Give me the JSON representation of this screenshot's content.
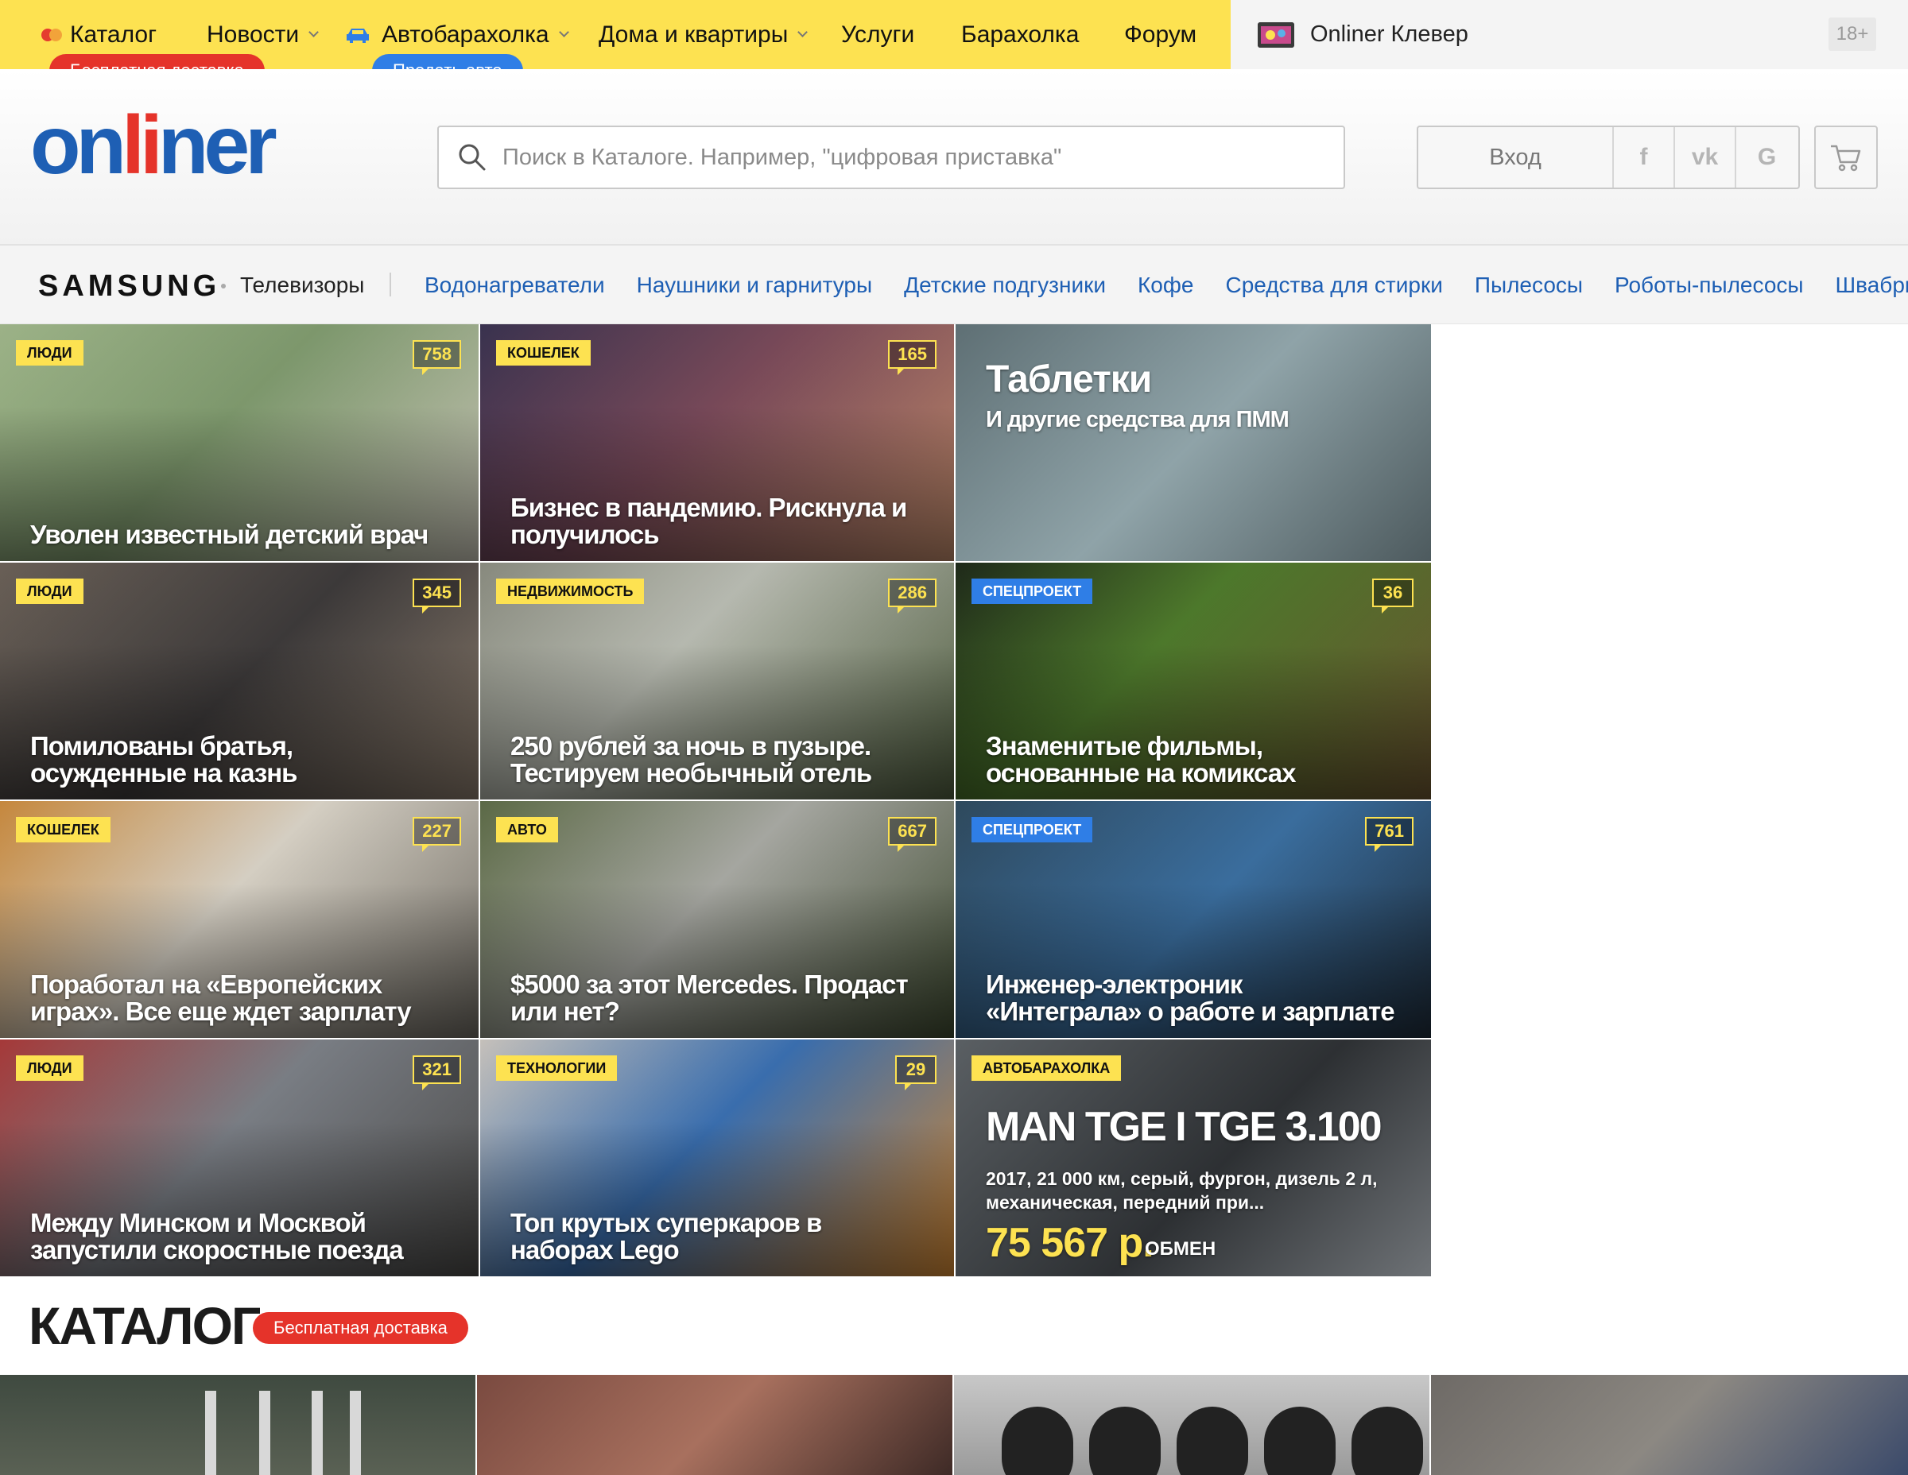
{
  "topnav": {
    "items": [
      {
        "label": "Каталог"
      },
      {
        "label": "Новости"
      },
      {
        "label": "Автобарахолка"
      },
      {
        "label": "Дома и квартиры"
      },
      {
        "label": "Услуги"
      },
      {
        "label": "Барахолка"
      },
      {
        "label": "Форум"
      }
    ],
    "catalog_badge": "Бесплатная доставка",
    "auto_badge": "Продать авто",
    "klever_label": "Onliner Клевер",
    "age_rating": "18+"
  },
  "header": {
    "logo": {
      "part1": "on",
      "part2": "li",
      "part3": "ner"
    },
    "search_placeholder": "Поиск в Каталоге. Например, \"цифровая приставка\"",
    "login_label": "Вход",
    "social": [
      "f",
      "vk",
      "G"
    ]
  },
  "catbar": {
    "brand": "SAMSUNG",
    "featured": "Телевизоры",
    "links": [
      "Водонагреватели",
      "Наушники и гарнитуры",
      "Детские подгузники",
      "Кофе",
      "Средства для стирки",
      "Пылесосы",
      "Роботы-пылесосы",
      "Швабры"
    ]
  },
  "news": [
    {
      "rubric": "ЛЮДИ",
      "comments": "758",
      "title": "Уволен известный детский врач"
    },
    {
      "rubric": "КОШЕЛЕК",
      "comments": "165",
      "title": "Бизнес в пандемию. Рискнула и получилось"
    },
    {
      "promo_title": "Таблетки",
      "promo_subtitle": "И другие средства для ПММ"
    },
    {
      "rubric": "ЛЮДИ",
      "comments": "345",
      "title": "Помилованы братья, осужденные на казнь"
    },
    {
      "rubric": "НЕДВИЖИМОСТЬ",
      "comments": "286",
      "title": "250 рублей за ночь в пузыре. Тестируем необычный отель"
    },
    {
      "rubric": "СПЕЦПРОЕКТ",
      "comments": "36",
      "title": "Знаменитые фильмы, основанные на комиксах"
    },
    {
      "rubric": "КОШЕЛЕК",
      "comments": "227",
      "title": "Поработал на «Европейских играх». Все еще ждет зарплату"
    },
    {
      "rubric": "АВТО",
      "comments": "667",
      "title": "$5000 за этот Mercedes. Продаст или нет?"
    },
    {
      "rubric": "СПЕЦПРОЕКТ",
      "comments": "761",
      "title": "Инженер-электроник «Интеграла» о работе и зарплате"
    },
    {
      "rubric": "ЛЮДИ",
      "comments": "321",
      "title": "Между Минском и Москвой запустили скоростные поезда"
    },
    {
      "rubric": "ТЕХНОЛОГИИ",
      "comments": "29",
      "title": "Топ крутых суперкаров в наборах Lego"
    },
    {
      "rubric": "АВТОБАРАХОЛКА",
      "ad_title": "MAN TGE I TGE 3.100",
      "ad_desc": "2017, 21 000 км, серый, фургон, дизель 2 л, механическая, передний при...",
      "ad_price": "75 567 р.",
      "ad_exchange": "ОБМЕН"
    }
  ],
  "catalog": {
    "title": "КАТАЛОГ",
    "badge": "Бесплатная доставка"
  }
}
